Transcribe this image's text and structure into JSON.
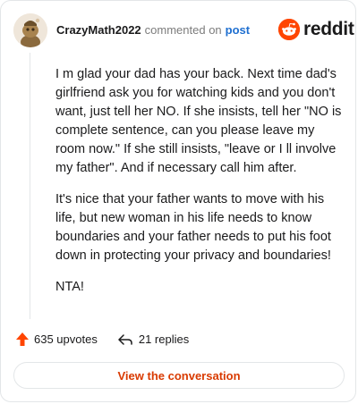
{
  "comment": {
    "username": "CrazyMath2022",
    "commented_on": "commented on",
    "post_link": "post",
    "body": [
      "I m glad your dad has your back. Next time dad's girlfriend ask you for watching kids and you don't want, just tell her NO. If she insists, tell her \"NO is complete sentence, can you please leave my room now.\" If she still insists, \"leave or I ll involve my father\". And if necessary call him after.",
      "It's nice that your father wants to move with his life, but new woman in his life needs to know boundaries and your father needs to put his foot down in protecting your privacy and boundaries!",
      "NTA!"
    ],
    "upvotes": "635 upvotes",
    "replies": "21 replies"
  },
  "logo": {
    "text": "reddit"
  },
  "footer": {
    "view_button_label": "View the conversation"
  },
  "colors": {
    "brand": "#ff4500",
    "link": "#1e6fd0",
    "button_text": "#d93a00"
  },
  "icons": {
    "avatar": "snoo-avatar-icon",
    "logo": "reddit-logo-icon",
    "upvote": "upvote-arrow-icon",
    "reply": "reply-arrow-icon"
  }
}
